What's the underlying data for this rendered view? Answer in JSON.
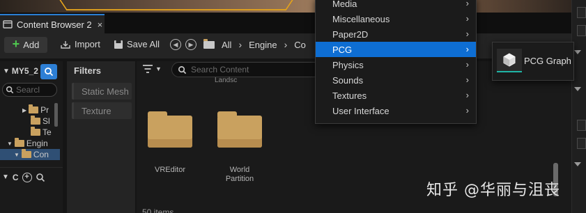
{
  "tab": {
    "title": "Content Browser 2",
    "close_glyph": "×",
    "icon": "content-browser-icon"
  },
  "toolbar": {
    "add_label": "Add",
    "import_label": "Import",
    "save_all_label": "Save All",
    "breadcrumbs": [
      "All",
      "Engine",
      "Co"
    ]
  },
  "left_panel": {
    "title": "MY5_2",
    "search_placeholder": "Searcl",
    "tree": [
      {
        "label": "Pr"
      },
      {
        "label": "Sl"
      },
      {
        "label": "Te"
      },
      {
        "label": "Engin"
      },
      {
        "label": "Con"
      }
    ],
    "collections_title": "C"
  },
  "filters": {
    "title": "Filters",
    "chips": [
      "Static Mesh",
      "Texture"
    ]
  },
  "main": {
    "search_placeholder": "Search Content",
    "partial_label": "Landsc",
    "assets": [
      {
        "label": "VREditor"
      },
      {
        "label": "World Partition"
      }
    ],
    "item_count": "50 items"
  },
  "menu": {
    "items": [
      {
        "label": "Media"
      },
      {
        "label": "Miscellaneous"
      },
      {
        "label": "Paper2D"
      },
      {
        "label": "PCG"
      },
      {
        "label": "Physics"
      },
      {
        "label": "Sounds"
      },
      {
        "label": "Textures"
      },
      {
        "label": "User Interface"
      }
    ],
    "active_index": 3,
    "submenu": {
      "label": "PCG Graph",
      "icon": "pcg-graph-icon"
    }
  },
  "watermark": "知乎 @华丽与沮丧",
  "colors": {
    "accent": "#0e6ed3",
    "folder": "#c9a15f",
    "add_green": "#4fc94f",
    "tab_highlight": "#2a7fd4",
    "pcg_teal": "#1fb5a6"
  }
}
